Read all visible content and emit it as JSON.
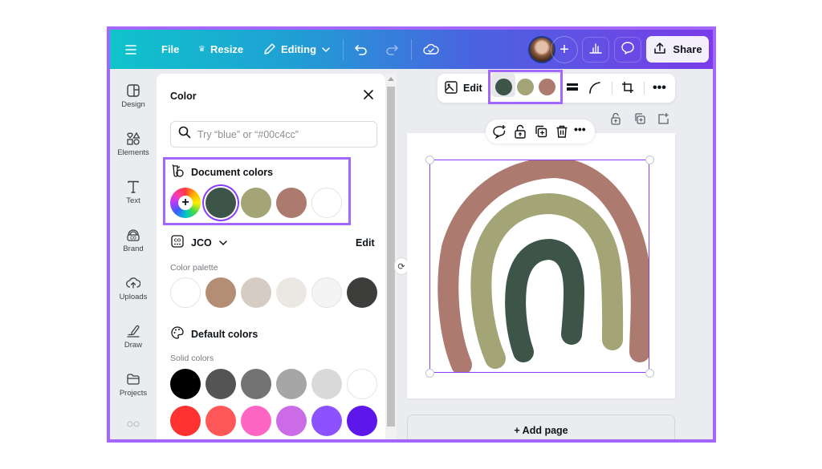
{
  "topbar": {
    "menu_icon": "hamburger-menu-icon",
    "file_label": "File",
    "resize_label": "Resize",
    "resize_icon": "crown-icon",
    "editing_label": "Editing",
    "editing_icon": "pencil-icon",
    "undo_icon": "undo-icon",
    "redo_icon": "redo-icon",
    "save_status_icon": "cloud-check-icon",
    "add_collaborator_icon": "plus-icon",
    "insights_icon": "bar-chart-icon",
    "comment_icon": "speech-bubble-icon",
    "share_label": "Share",
    "share_icon": "upload-icon"
  },
  "rail": {
    "items": [
      {
        "label": "Design",
        "icon": "layout-icon"
      },
      {
        "label": "Elements",
        "icon": "shapes-icon"
      },
      {
        "label": "Text",
        "icon": "text-icon"
      },
      {
        "label": "Brand",
        "icon": "brand-kit-icon"
      },
      {
        "label": "Uploads",
        "icon": "cloud-upload-icon"
      },
      {
        "label": "Draw",
        "icon": "draw-pen-icon"
      },
      {
        "label": "Projects",
        "icon": "folder-icon"
      }
    ]
  },
  "color_panel": {
    "title": "Color",
    "search_placeholder": "Try “blue” or “#00c4cc”",
    "search_value": "",
    "document_colors": {
      "title": "Document colors",
      "add_label": "+",
      "swatches": [
        "#3d5449",
        "#a3a577",
        "#ad7a70",
        "#ffffff"
      ],
      "selected_index": 0
    },
    "brand_kit": {
      "name": "JCO",
      "edit_label": "Edit",
      "palette_label": "Color palette",
      "swatches": [
        "#ffffff",
        "#b38e74",
        "#d6ccc3",
        "#ebe7e3",
        "#f4f4f5",
        "#3d3d3c"
      ]
    },
    "default_colors": {
      "title": "Default colors",
      "solid_label": "Solid colors",
      "row1": [
        "#000000",
        "#545454",
        "#737373",
        "#a6a6a6",
        "#d9d9d9",
        "#ffffff"
      ],
      "row2": [
        "#ff3131",
        "#ff5757",
        "#ff66c4",
        "#cb6ce6",
        "#8c52ff",
        "#5e17eb"
      ]
    }
  },
  "context_toolbar": {
    "edit_label": "Edit",
    "edit_icon": "image-edit-icon",
    "colors": [
      "#3d5449",
      "#a3a577",
      "#ad7a70"
    ],
    "border_style_icon": "border-weight-icon",
    "corner_icon": "corner-rounding-icon",
    "crop_icon": "crop-icon",
    "more_icon": "more-horizontal-icon"
  },
  "element_toolbar": {
    "icons": [
      "comment-add-icon",
      "lock-icon",
      "duplicate-icon",
      "trash-icon",
      "more-horizontal-icon"
    ]
  },
  "page_actions": {
    "icons": [
      "lock-icon",
      "duplicate-page-icon",
      "add-page-icon"
    ]
  },
  "canvas": {
    "arc_colors": {
      "outer": "#ad7a70",
      "middle": "#a3a577",
      "inner": "#3d5449"
    }
  },
  "add_page_label": "+ Add page"
}
